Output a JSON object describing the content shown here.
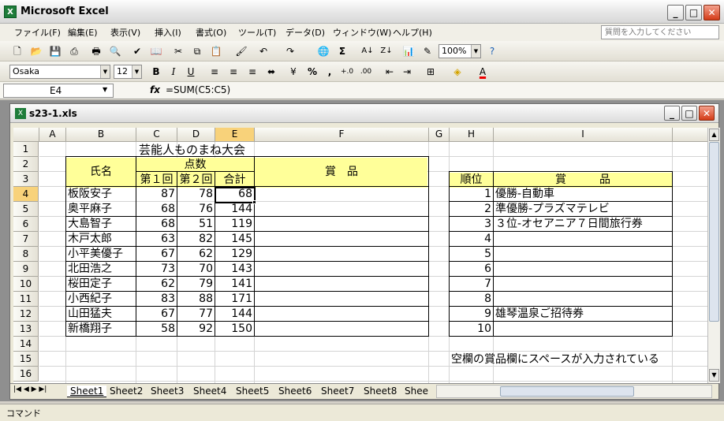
{
  "app": {
    "title": "Microsoft Excel",
    "icon": "excel-icon"
  },
  "menu": [
    "ファイル(F)",
    "編集(E)",
    "表示(V)",
    "挿入(I)",
    "書式(O)",
    "ツール(T)",
    "データ(D)",
    "ウィンドウ(W)",
    "ヘルプ(H)"
  ],
  "help_placeholder": "質問を入力してください",
  "toolbar": {
    "zoom": "100%",
    "font": "Osaka",
    "size": "12",
    "sigma": "Σ",
    "bold": "B",
    "italic": "I",
    "underline": "U",
    "percent": "%",
    "comma": ",",
    "font_color_letter": "A"
  },
  "formula_bar": {
    "name_box": "E4",
    "fx": "fx",
    "formula": "=SUM(C5:C5)"
  },
  "workbook": {
    "title": "s23-1.xls"
  },
  "columns": [
    "A",
    "B",
    "C",
    "D",
    "E",
    "F",
    "G",
    "H",
    "I"
  ],
  "rows": [
    "1",
    "2",
    "3",
    "4",
    "5",
    "6",
    "7",
    "8",
    "9",
    "10",
    "11",
    "12",
    "13",
    "14",
    "15",
    "16"
  ],
  "sheet": {
    "title": "芸能人ものまね大会",
    "h_name": "氏名",
    "h_score": "点数",
    "h_r1": "第１回",
    "h_r2": "第２回",
    "h_total": "合計",
    "h_prize": "賞　品",
    "h_rank": "順位",
    "h_prize2": "賞　　　品",
    "data": [
      {
        "name": "板阪安子",
        "r1": "87",
        "r2": "78",
        "total": "68"
      },
      {
        "name": "奥平麻子",
        "r1": "68",
        "r2": "76",
        "total": "144"
      },
      {
        "name": "大島智子",
        "r1": "68",
        "r2": "51",
        "total": "119"
      },
      {
        "name": "木戸太郎",
        "r1": "63",
        "r2": "82",
        "total": "145"
      },
      {
        "name": "小平美優子",
        "r1": "67",
        "r2": "62",
        "total": "129"
      },
      {
        "name": "北田浩之",
        "r1": "73",
        "r2": "70",
        "total": "143"
      },
      {
        "name": "桜田定子",
        "r1": "62",
        "r2": "79",
        "total": "141"
      },
      {
        "name": "小西紀子",
        "r1": "83",
        "r2": "88",
        "total": "171"
      },
      {
        "name": "山田猛夫",
        "r1": "67",
        "r2": "77",
        "total": "144"
      },
      {
        "name": "新橋翔子",
        "r1": "58",
        "r2": "92",
        "total": "150"
      }
    ],
    "ranks": [
      {
        "rank": "1",
        "prize": "優勝-自動車"
      },
      {
        "rank": "2",
        "prize": "準優勝-プラズマテレビ"
      },
      {
        "rank": "3",
        "prize": "３位-オセアニア７日間旅行券"
      },
      {
        "rank": "4",
        "prize": ""
      },
      {
        "rank": "5",
        "prize": ""
      },
      {
        "rank": "6",
        "prize": ""
      },
      {
        "rank": "7",
        "prize": ""
      },
      {
        "rank": "8",
        "prize": ""
      },
      {
        "rank": "9",
        "prize": "雄琴温泉ご招待券"
      },
      {
        "rank": "10",
        "prize": ""
      }
    ],
    "note": "空欄の賞品欄にスペースが入力されている"
  },
  "tabs": [
    "Sheet1",
    "Sheet2",
    "Sheet3",
    "Sheet4",
    "Sheet5",
    "Sheet6",
    "Sheet7",
    "Sheet8",
    "Shee"
  ],
  "status": "コマンド",
  "colors": {
    "header_fill": "#ffff99",
    "selected_header": "#f8d27a"
  }
}
